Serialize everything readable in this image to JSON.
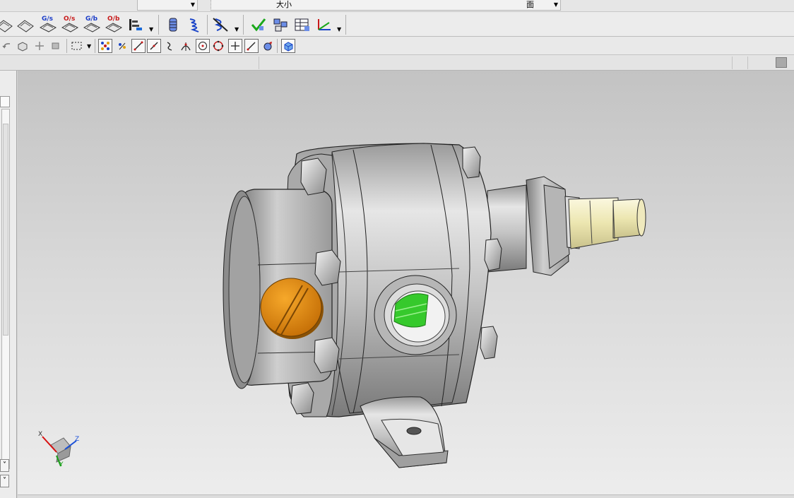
{
  "top_bar": {
    "size_label": "大小",
    "face_label": "面"
  },
  "toolbar1": {
    "icons": [
      "analysis-icon",
      "analysis-icon",
      "curvature-gs-icon",
      "curvature-os-icon",
      "curvature-gb-icon",
      "curvature-ob-icon",
      "deviation-icon",
      "spring-stack-icon",
      "spring-icon",
      "part-navigator-icon",
      "check-icon",
      "assembly-icon",
      "table-icon",
      "coordinate-icon"
    ],
    "labels": {
      "gs": "G/s",
      "os": "O/s",
      "gb": "G/b",
      "ob": "O/b"
    }
  },
  "toolbar2": {
    "icons": [
      "undo-icon",
      "box-icon",
      "pan-icon",
      "rotate-icon",
      "select-rect-icon",
      "snap-grid-icon",
      "snap-points-icon",
      "line-icon",
      "tangent-line-icon",
      "curve-icon",
      "intersection-icon",
      "circle-center-icon",
      "circle-icon",
      "plus-icon",
      "slash-icon",
      "arc-icon",
      "solid-view-icon"
    ]
  },
  "viewport": {
    "colors": {
      "body_metal": "#c4c4c4",
      "cap_orange": "#e08a0c",
      "shaft_cream": "#f0ecc2",
      "port_green": "#36c92c",
      "triad_red": "#d81010",
      "triad_blue": "#1a50d8",
      "triad_green": "#1aa01a"
    },
    "triad": {
      "x": "X",
      "y": "Y",
      "z": "Z"
    }
  }
}
